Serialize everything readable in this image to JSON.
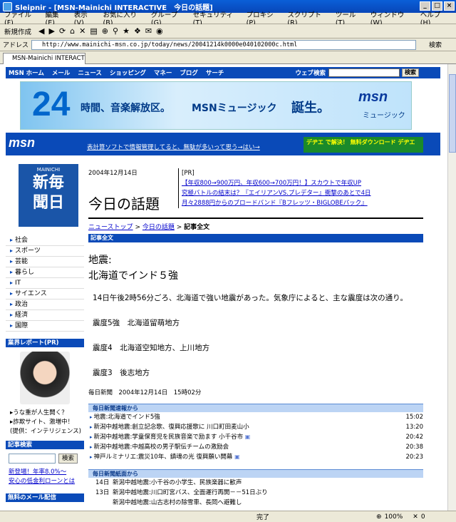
{
  "window": {
    "title": "Sleipnir - [MSN-Mainichi INTERACTIVE　今日の話題]"
  },
  "menu": [
    "ファイル(F)",
    "編集(E)",
    "表示(V)",
    "お気に入り(B)",
    "グループ(G)",
    "セキュリティ(T)",
    "プロキシ(P)",
    "スクリプト(R)",
    "ツール(T)",
    "ウィンドウ(W)",
    "ヘルプ(H)"
  ],
  "toolbar": {
    "new_label": "新規作成"
  },
  "address": {
    "label": "アドレス",
    "url": "http://www.mainichi-msn.co.jp/today/news/20041214k0000e040102000c.html",
    "search_label": "検索"
  },
  "tab": {
    "label": "MSN-Mainichi INTERACTI..."
  },
  "msn": {
    "nav": [
      "MSN ホーム",
      "メール",
      "ニュース",
      "ショッピング",
      "マネー",
      "ブログ",
      "サーチ"
    ],
    "web_search_label": "ウェブ検索",
    "web_search_button": "検索",
    "banner": {
      "big": "24",
      "t1": "時間、音楽解放区。",
      "t2": "MSNミュージック",
      "t3": "誕生。",
      "logo": "msn",
      "logo_sub": "ミュージック"
    },
    "logo": "msn",
    "ad_text": "表計算ソフトで情報管理してると、無駄が多いって思う→はい→",
    "promo": "デヂエ で解決！ 無料ダウンロード デヂエ"
  },
  "left": {
    "masthead_top": "MAINICHI",
    "masthead_title_1": "新毎",
    "masthead_title_2": "聞日",
    "nav": [
      "社会",
      "スポーツ",
      "芸能",
      "暮らし",
      "IT",
      "サイエンス",
      "政治",
      "経済",
      "国際"
    ],
    "report_head": "業界レポート(PR)",
    "report_links": [
      "▸うな重が人生開く？",
      "▸詐欺サイト、激増中！",
      "(提供：インテリジェンス)"
    ],
    "article_search_head": "記事検索",
    "search_button": "検索",
    "ad_links": [
      "新登場！年率8.0%～",
      "安心の低金利ローンとは"
    ],
    "bottom_head": "無料のメール配信"
  },
  "main": {
    "date": "2004年12月14日",
    "headline": "今日の話題",
    "pr_label": "[PR]",
    "pr_links": [
      "【年収800→900万円、年収600→700万円！】スカウトで年収UP",
      "究極バトルの結末は？『エイリアンVS.プレデター』衝撃のあとで4日",
      "月々2888円からのブロードバンド『Bフレッツ・BIGLOBEパック』"
    ],
    "breadcrumb_top": "ニューストップ",
    "breadcrumb_mid": "今日の話題",
    "breadcrumb_cur": "記事全文",
    "section_label": "記事全文",
    "article_title_1": "地震:",
    "article_title_2": "北海道でインド５強",
    "article_body": "14日午後2時56分ごろ、北海道で強い地震があった。気象庁によると、主な震度は次の通り。",
    "quake_1": "震度5強　北海道留萌地方",
    "quake_2": "震度4　北海道空知地方、上川地方",
    "quake_3": "震度3　後志地方",
    "pub": "毎日新聞　2004年12月14日　15時02分",
    "flash_head": "毎日新聞速報から",
    "flash": [
      {
        "t": "地震:北海道でインド5強",
        "time": "15:02"
      },
      {
        "t": "新潟中越地震:創立記念歌、復興応援歌に 川口町田麦山小",
        "time": "13:20"
      },
      {
        "t": "新潟中越地震:学童保育児を民族音楽で励ます 小千谷市",
        "time": "20:42"
      },
      {
        "t": "新潟中越地震:中越高校の男子駅伝チームの激励会",
        "time": "20:38"
      },
      {
        "t": "神戸ルミナリエ:震災10年、鎮魂の光 復興願い開幕",
        "time": "20:23"
      }
    ],
    "paper_head": "毎日新聞紙面から",
    "paper": [
      {
        "d": "14日",
        "t": "新潟中越地震:小千谷の小学生、民族楽器に歓声"
      },
      {
        "d": "13日",
        "t": "新潟中越地震:川口町宮バス、全面運行再開－－51日ぶり"
      },
      {
        "d": "",
        "t": "新潟中越地震:山古志村の除雪車、長岡へ避難し"
      }
    ]
  },
  "status": {
    "text": "完了",
    "zoom": "100%",
    "count": "0"
  }
}
